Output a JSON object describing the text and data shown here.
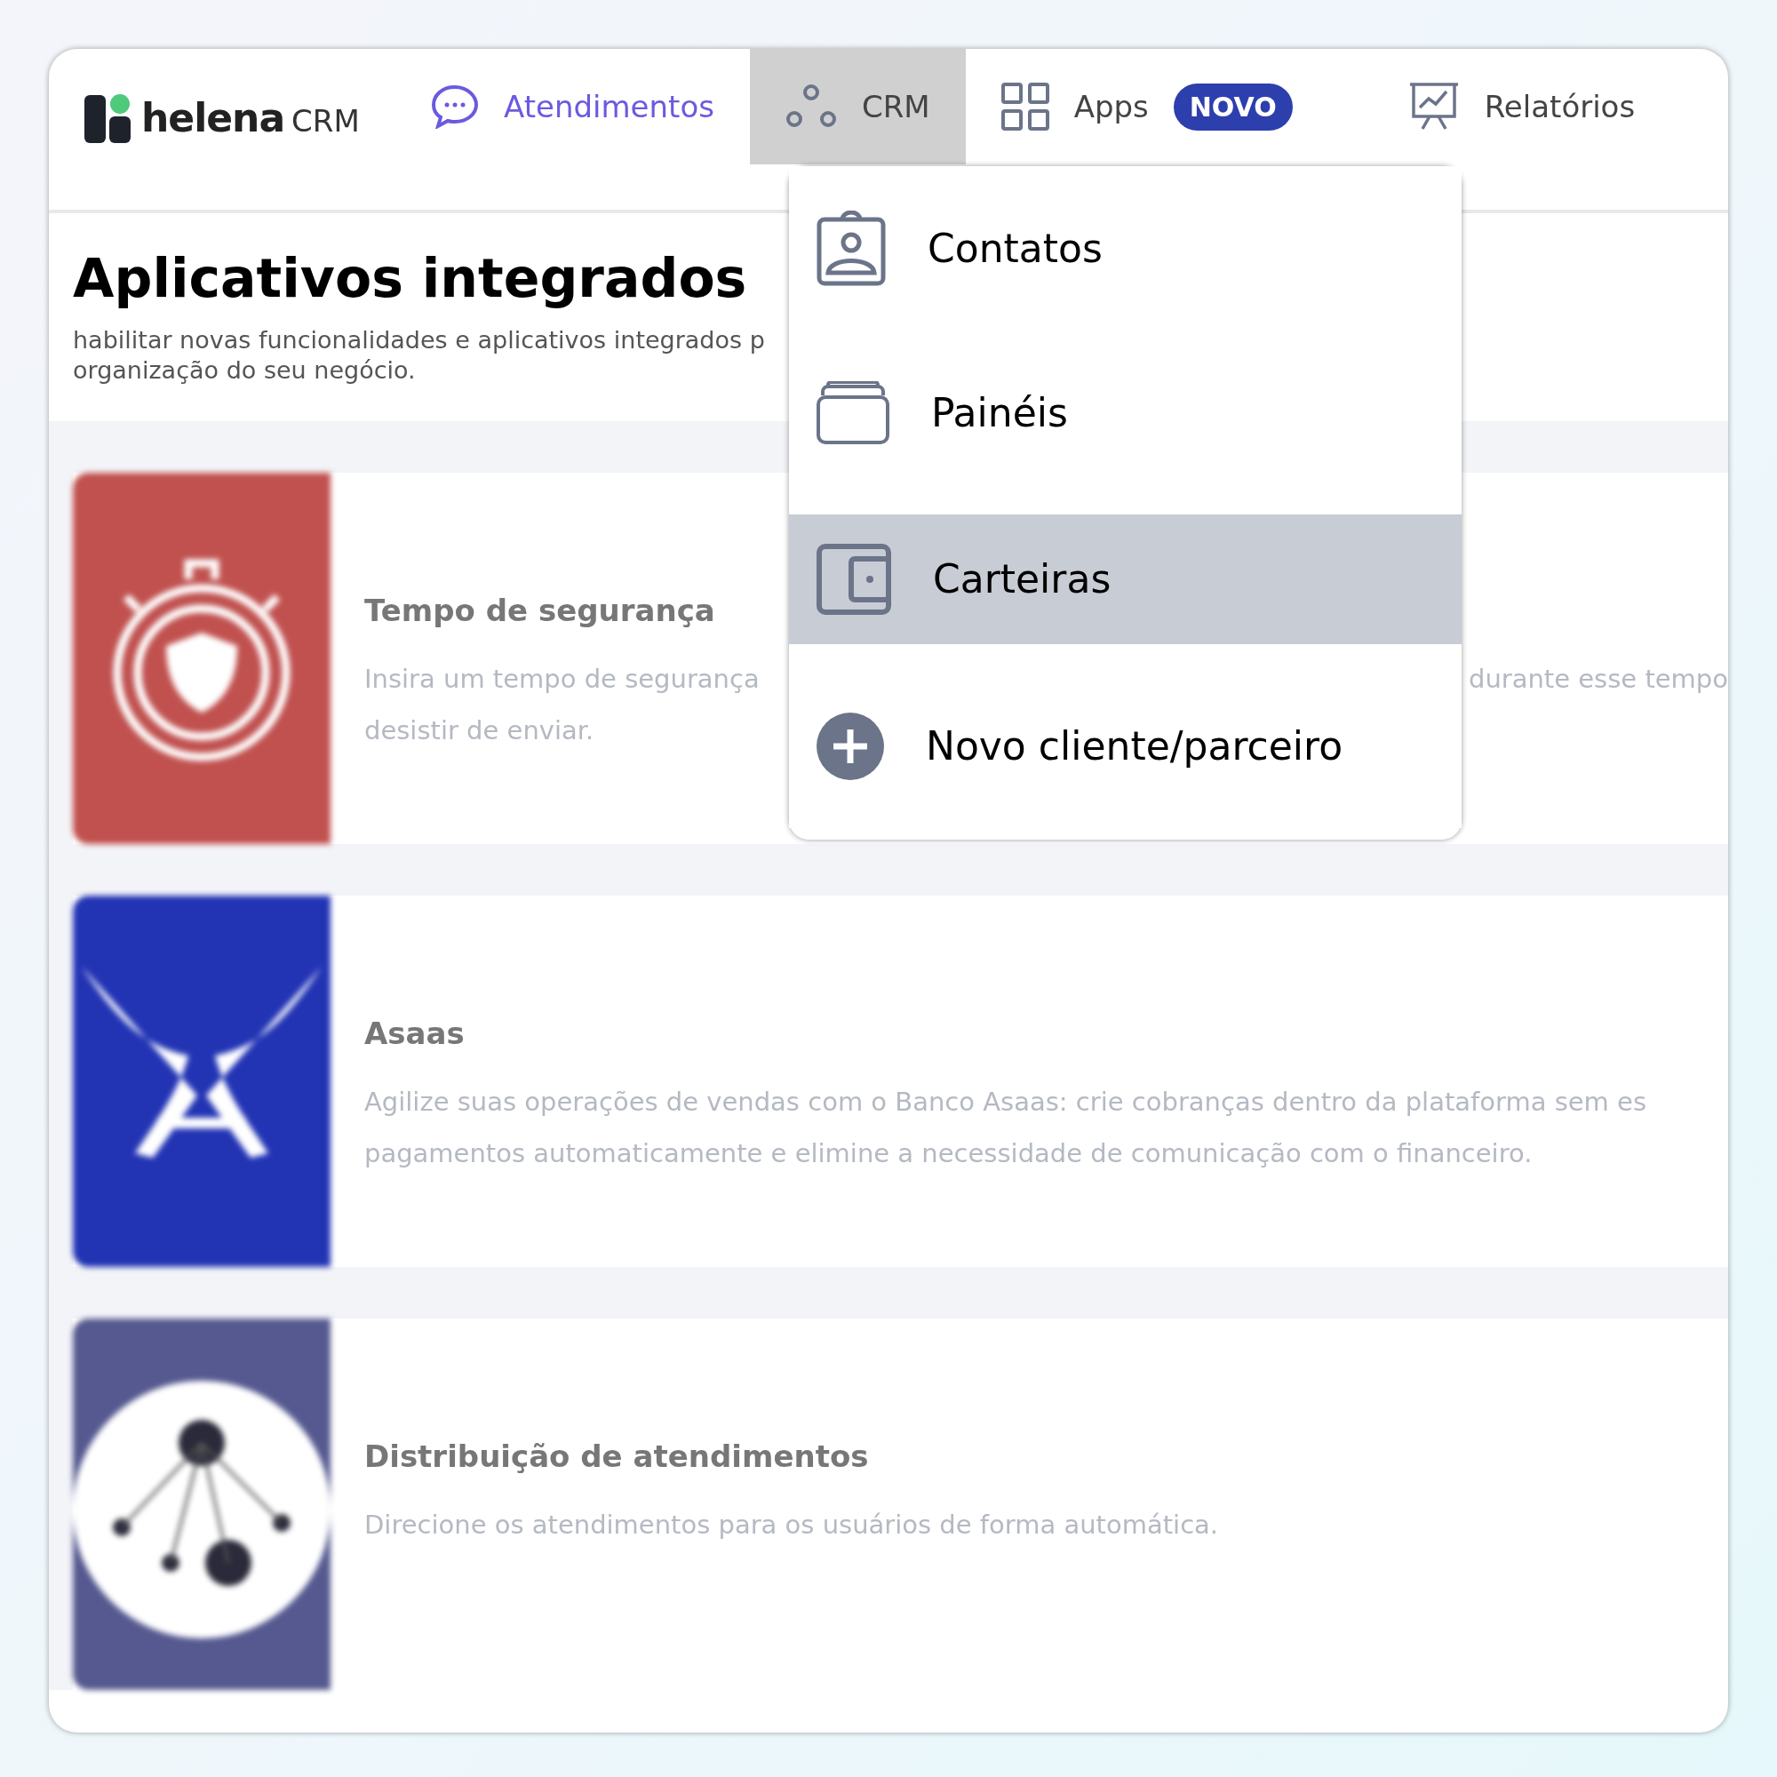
{
  "brand": {
    "name": "helena",
    "suffix": "CRM"
  },
  "nav": [
    {
      "label": "Atendimentos",
      "kind": "chat",
      "selected": true,
      "expanded": false
    },
    {
      "label": "CRM",
      "kind": "crm",
      "selected": false,
      "expanded": true
    },
    {
      "label": "Apps",
      "kind": "apps",
      "selected": false,
      "expanded": false,
      "badge": "NOVO"
    },
    {
      "label": "Relatórios",
      "kind": "reports",
      "selected": false,
      "expanded": false
    }
  ],
  "page": {
    "title": "Aplicativos integrados",
    "subtitle_lines": [
      "habilitar novas funcionalidades e aplicativos integrados p",
      "organização do seu negócio."
    ]
  },
  "apps": [
    {
      "kind": "stopwatch",
      "color": "#c0514f",
      "title": "Tempo de segurança",
      "lines": [
        [
          "Insira um tempo de segurança",
          "durante esse tempo"
        ],
        [
          "desistir de enviar."
        ]
      ]
    },
    {
      "kind": "wings",
      "color": "#2234b4",
      "title": "Asaas",
      "lines": [
        [
          "Agilize suas operações de vendas com o Banco Asaas: crie cobranças dentro da plataforma sem es"
        ],
        [
          "pagamentos automaticamente e elimine a necessidade de comunicação com o financeiro."
        ]
      ]
    },
    {
      "kind": "network",
      "color": "#55598f",
      "title": "Distribuição de atendimentos",
      "lines": [
        [
          "Direcione os atendimentos para os usuários de forma automática."
        ]
      ]
    }
  ],
  "menu": [
    {
      "label": "Contatos",
      "kind": "contacts",
      "selected": false
    },
    {
      "label": "Painéis",
      "kind": "boards",
      "selected": false
    },
    {
      "label": "Carteiras",
      "kind": "wallet",
      "selected": true
    },
    {
      "label": "Novo cliente/parceiro",
      "kind": "add",
      "selected": false
    }
  ]
}
